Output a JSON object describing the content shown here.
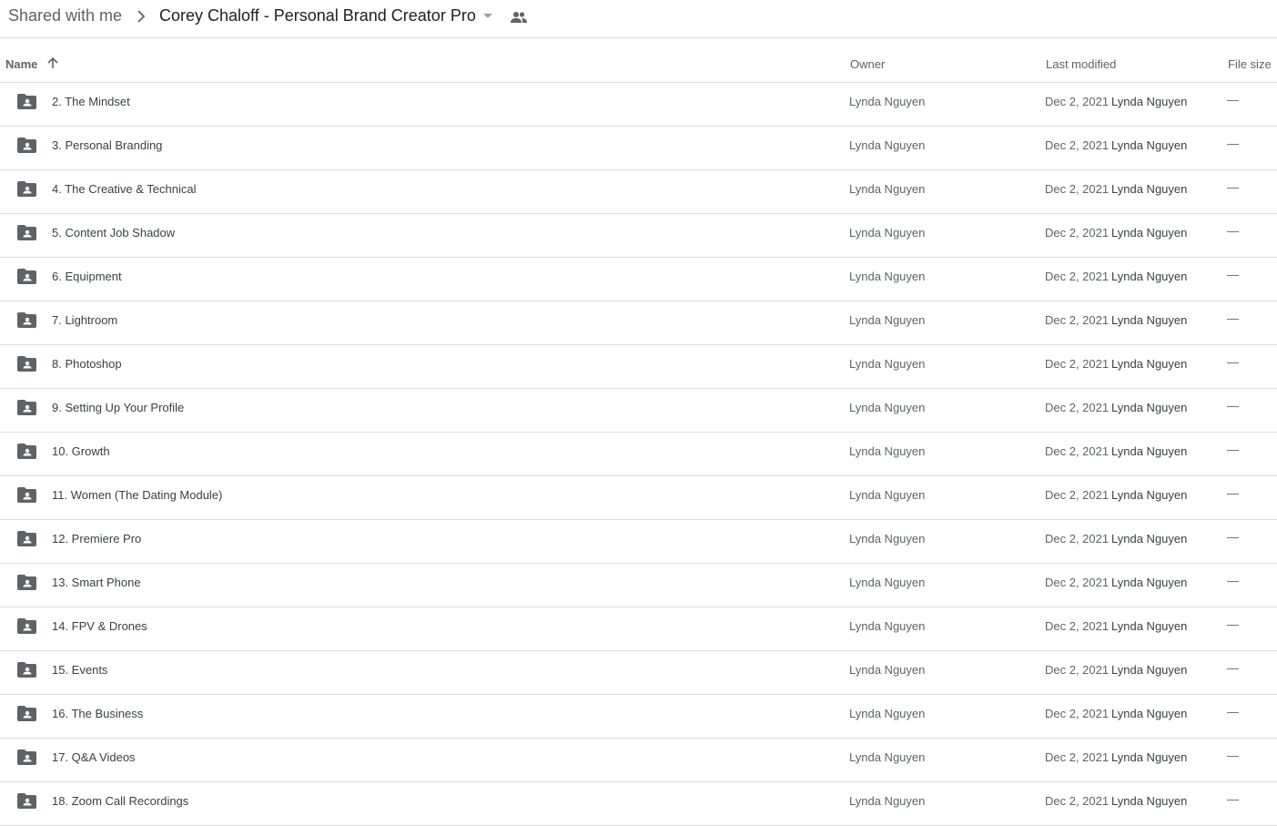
{
  "breadcrumb": {
    "root": "Shared with me",
    "separator_icon": "chevron-right-icon",
    "current": "Corey Chaloff - Personal Brand Creator Pro",
    "caret_icon": "caret-down-icon",
    "shared_icon": "people-icon"
  },
  "columns": {
    "name": "Name",
    "sort_icon": "arrow-up-icon",
    "owner": "Owner",
    "last_modified": "Last modified",
    "file_size": "File size"
  },
  "rows": [
    {
      "name": "2. The Mindset",
      "owner": "Lynda Nguyen",
      "date": "Dec 2, 2021",
      "modified_by": "Lynda Nguyen",
      "size": "—"
    },
    {
      "name": "3. Personal Branding",
      "owner": "Lynda Nguyen",
      "date": "Dec 2, 2021",
      "modified_by": "Lynda Nguyen",
      "size": "—"
    },
    {
      "name": "4. The Creative & Technical",
      "owner": "Lynda Nguyen",
      "date": "Dec 2, 2021",
      "modified_by": "Lynda Nguyen",
      "size": "—"
    },
    {
      "name": "5. Content Job Shadow",
      "owner": "Lynda Nguyen",
      "date": "Dec 2, 2021",
      "modified_by": "Lynda Nguyen",
      "size": "—"
    },
    {
      "name": "6. Equipment",
      "owner": "Lynda Nguyen",
      "date": "Dec 2, 2021",
      "modified_by": "Lynda Nguyen",
      "size": "—"
    },
    {
      "name": "7. Lightroom",
      "owner": "Lynda Nguyen",
      "date": "Dec 2, 2021",
      "modified_by": "Lynda Nguyen",
      "size": "—"
    },
    {
      "name": "8. Photoshop",
      "owner": "Lynda Nguyen",
      "date": "Dec 2, 2021",
      "modified_by": "Lynda Nguyen",
      "size": "—"
    },
    {
      "name": "9. Setting Up Your Profile",
      "owner": "Lynda Nguyen",
      "date": "Dec 2, 2021",
      "modified_by": "Lynda Nguyen",
      "size": "—"
    },
    {
      "name": "10. Growth",
      "owner": "Lynda Nguyen",
      "date": "Dec 2, 2021",
      "modified_by": "Lynda Nguyen",
      "size": "—"
    },
    {
      "name": "11. Women (The Dating Module)",
      "owner": "Lynda Nguyen",
      "date": "Dec 2, 2021",
      "modified_by": "Lynda Nguyen",
      "size": "—"
    },
    {
      "name": "12. Premiere Pro",
      "owner": "Lynda Nguyen",
      "date": "Dec 2, 2021",
      "modified_by": "Lynda Nguyen",
      "size": "—"
    },
    {
      "name": "13. Smart Phone",
      "owner": "Lynda Nguyen",
      "date": "Dec 2, 2021",
      "modified_by": "Lynda Nguyen",
      "size": "—"
    },
    {
      "name": "14. FPV & Drones",
      "owner": "Lynda Nguyen",
      "date": "Dec 2, 2021",
      "modified_by": "Lynda Nguyen",
      "size": "—"
    },
    {
      "name": "15. Events",
      "owner": "Lynda Nguyen",
      "date": "Dec 2, 2021",
      "modified_by": "Lynda Nguyen",
      "size": "—"
    },
    {
      "name": "16. The Business",
      "owner": "Lynda Nguyen",
      "date": "Dec 2, 2021",
      "modified_by": "Lynda Nguyen",
      "size": "—"
    },
    {
      "name": "17. Q&A Videos",
      "owner": "Lynda Nguyen",
      "date": "Dec 2, 2021",
      "modified_by": "Lynda Nguyen",
      "size": "—"
    },
    {
      "name": "18. Zoom Call Recordings",
      "owner": "Lynda Nguyen",
      "date": "Dec 2, 2021",
      "modified_by": "Lynda Nguyen",
      "size": "—"
    }
  ],
  "row_icon": "shared-folder-icon",
  "colors": {
    "icon": "#5f6368",
    "divider": "#dadce0",
    "text": "#3c4043"
  }
}
